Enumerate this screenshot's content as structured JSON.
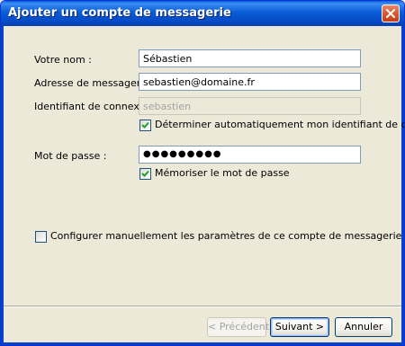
{
  "window": {
    "title": "Ajouter un compte de messagerie"
  },
  "form": {
    "name_label": "Votre nom :",
    "name_value": "Sébastien",
    "email_label": "Adresse de messagerie :",
    "email_value": "sebastien@domaine.fr",
    "login_label": "Identifiant de connexion :",
    "login_value": "sebastien",
    "auto_login_label": "Déterminer automatiquement mon identifiant de connexion",
    "auto_login_checked": true,
    "password_label": "Mot de passe :",
    "password_value": "●●●●●●●●●",
    "remember_label": "Mémoriser le mot de passe",
    "remember_checked": true,
    "manual_config_label": "Configurer manuellement les paramètres de ce compte de messagerie",
    "manual_config_checked": false
  },
  "buttons": {
    "previous": "< Précédent",
    "next": "Suivant >",
    "cancel": "Annuler"
  }
}
